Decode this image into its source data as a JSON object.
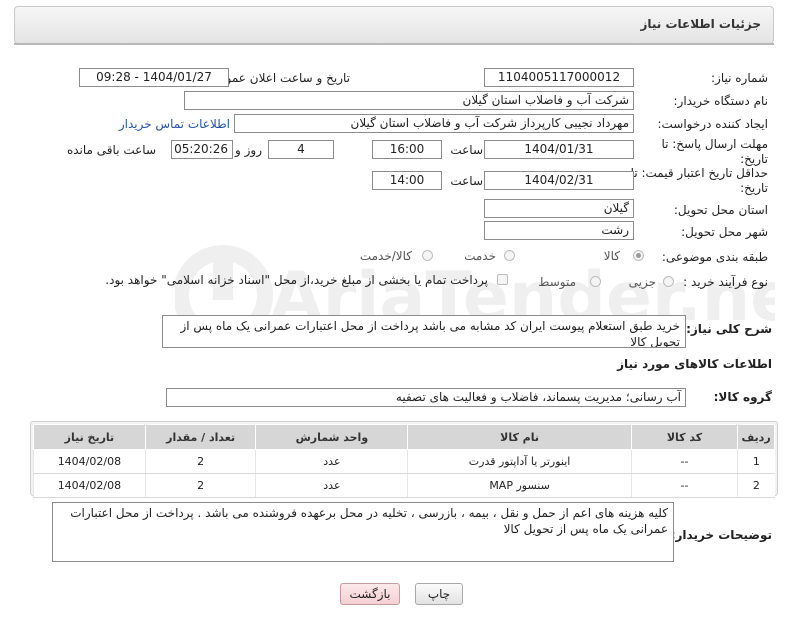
{
  "header": {
    "title": "جزئیات اطلاعات نیاز"
  },
  "form": {
    "need_number": {
      "label": "شماره نیاز:",
      "value": "1104005117000012"
    },
    "announce_datetime": {
      "label": "تاریخ و ساعت اعلان عمومی:",
      "value": "1404/01/27 - 09:28"
    },
    "buyer_org": {
      "label": "نام دستگاه خریدار:",
      "value": "شرکت آب و فاضلاب استان گیلان"
    },
    "requester": {
      "label": "ایجاد کننده درخواست:",
      "value": "مهرداد نجیبی کارپرداز شرکت آب و فاضلاب استان گیلان",
      "contact_link": "اطلاعات تماس خریدار"
    },
    "reply_deadline": {
      "label": "مهلت ارسال پاسخ: تا تاریخ:",
      "date": "1404/01/31",
      "time_label": "ساعت",
      "time": "16:00",
      "days": "4",
      "days_label": "روز و",
      "remaining": "05:20:26",
      "remaining_label": "ساعت باقی مانده"
    },
    "price_validity": {
      "label": "حداقل تاریخ اعتبار قیمت: تا تاریخ:",
      "date": "1404/02/31",
      "time_label": "ساعت",
      "time": "14:00"
    },
    "delivery_province": {
      "label": "استان محل تحویل:",
      "value": "گیلان"
    },
    "delivery_city": {
      "label": "شهر محل تحویل:",
      "value": "رشت"
    },
    "category": {
      "label": "طبقه بندی موضوعی:",
      "options": [
        "کالا",
        "خدمت",
        "کالا/خدمت"
      ],
      "selected": "کالا"
    },
    "process_type": {
      "label": "نوع فرآیند خرید :",
      "options": [
        "جزیی",
        "متوسط"
      ],
      "payment_note": "پرداخت تمام یا بخشی از مبلغ خرید،از محل \"اسناد خزانه اسلامی\" خواهد بود."
    },
    "description": {
      "label": "شرح کلی نیاز:",
      "value": "خرید طبق استعلام پیوست ایران کد مشابه می باشد پرداخت از محل اعتبارات عمرانی یک ماه پس از تحویل کالا"
    }
  },
  "goods": {
    "section_title": "اطلاعات کالاهای مورد نیاز",
    "group_label": "گروه کالا:",
    "group_value": "آب رسانی؛ مدیریت پسماند، فاضلاب و فعالیت های تصفیه",
    "columns": [
      "ردیف",
      "کد کالا",
      "نام کالا",
      "واحد شمارش",
      "تعداد / مقدار",
      "تاریخ نیاز"
    ],
    "rows": [
      {
        "row": "1",
        "code": "--",
        "name": "اینورتر یا آداپتور قدرت",
        "unit": "عدد",
        "qty": "2",
        "date": "1404/02/08"
      },
      {
        "row": "2",
        "code": "--",
        "name": "سنسور MAP",
        "unit": "عدد",
        "qty": "2",
        "date": "1404/02/08"
      }
    ]
  },
  "buyer_notes": {
    "label": "توضیحات خریدار:",
    "value": "کلیه هزینه های اعم از حمل و نقل ، بیمه ، بازرسی ، تخلیه در محل برعهده فروشنده می باشد . پرداخت از محل اعتبارات عمرانی یک ماه پس از تحویل کالا"
  },
  "actions": {
    "print_label": "چاپ",
    "back_label": "بازگشت"
  },
  "watermark": {
    "text": "AriaTender.neT"
  }
}
